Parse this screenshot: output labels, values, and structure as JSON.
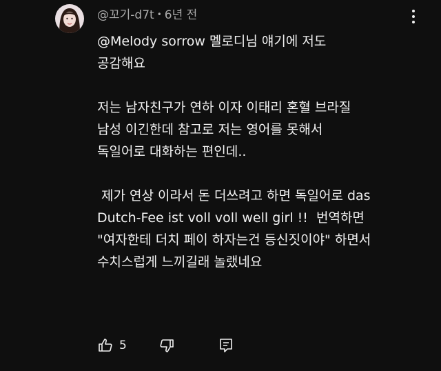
{
  "comment": {
    "author": "@꼬기-d7t",
    "separator": "•",
    "timestamp": "6년 전",
    "paragraphs": [
      [
        "@Melody sorrow 멜로디님 얘기에 저도",
        "공감해요"
      ],
      [
        "저는 남자친구가 연하 이자 이태리 혼혈 브라질",
        "남성 이긴한데 참고로 저는 영어를 못해서",
        "독일어로 대화하는 편인데.."
      ],
      [
        " 제가 연상 이라서 돈 더쓰려고 하면 독일어로 das",
        "Dutch-Fee ist voll voll well girl !!  번역하면",
        "\"여자한테 더치 페이 하자는건 등신짓이야\" 하면서",
        "수치스럽게 느끼길래 놀랬네요"
      ]
    ],
    "like_count": "5"
  },
  "icons": {
    "avatar": "profile-avatar",
    "menu": "more-vert-icon",
    "like": "thumb-up-icon",
    "dislike": "thumb-down-icon",
    "reply": "comment-reply-icon"
  },
  "colors": {
    "background": "#0f0f0f",
    "text": "#f1f1f1",
    "secondary_text": "#aaaaaa"
  }
}
